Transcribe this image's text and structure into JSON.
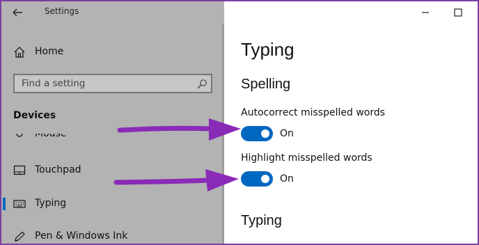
{
  "window": {
    "app_title": "Settings"
  },
  "sidebar": {
    "home_label": "Home",
    "search_placeholder": "Find a setting",
    "section_title": "Devices",
    "partial_item_label": "Mouse",
    "items": [
      {
        "label": "Touchpad",
        "icon": "touchpad-icon",
        "active": false
      },
      {
        "label": "Typing",
        "icon": "keyboard-icon",
        "active": true
      },
      {
        "label": "Pen & Windows Ink",
        "icon": "pen-icon",
        "active": false
      }
    ]
  },
  "main": {
    "page_title": "Typing",
    "spelling_heading": "Spelling",
    "settings": [
      {
        "label": "Autocorrect misspelled words",
        "state": "On",
        "on": true
      },
      {
        "label": "Highlight misspelled words",
        "state": "On",
        "on": true
      }
    ],
    "typing_heading": "Typing"
  },
  "colors": {
    "accent": "#0067c0",
    "annotation_arrow": "#8a2bb8",
    "sidebar_bg": "#b3b3b3"
  }
}
